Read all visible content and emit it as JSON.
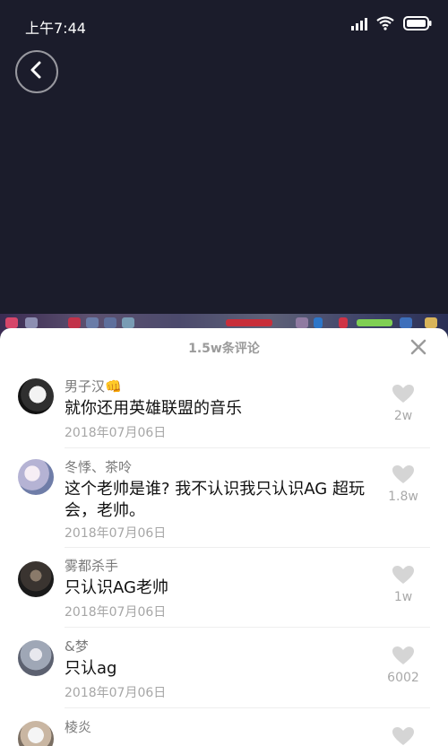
{
  "status_bar": {
    "time": "上午7:44",
    "icons": [
      "signal-icon",
      "wifi-icon",
      "battery-icon"
    ]
  },
  "video": {
    "back_icon": "back-icon"
  },
  "sheet": {
    "title": "1.5w条评论",
    "close_icon": "close-icon"
  },
  "comments": [
    {
      "user": "男子汉👊",
      "text": "就你还用英雄联盟的音乐",
      "date": "2018年07月06日",
      "likes": "2w"
    },
    {
      "user": "冬悸、茶呤",
      "text": "这个老帅是谁? 我不认识我只认识AG 超玩会，老帅。",
      "date": "2018年07月06日",
      "likes": "1.8w"
    },
    {
      "user": "雾都杀手",
      "text": "只认识AG老帅",
      "date": "2018年07月06日",
      "likes": "1w"
    },
    {
      "user": "&梦",
      "text": "只认ag",
      "date": "2018年07月06日",
      "likes": "6002"
    },
    {
      "user": "棱炎",
      "text": "",
      "date": "",
      "likes": ""
    }
  ],
  "colors": {
    "video_bg": "#1b1c2b",
    "sheet_bg": "#ffffff",
    "muted_text": "#9b9b9b"
  }
}
